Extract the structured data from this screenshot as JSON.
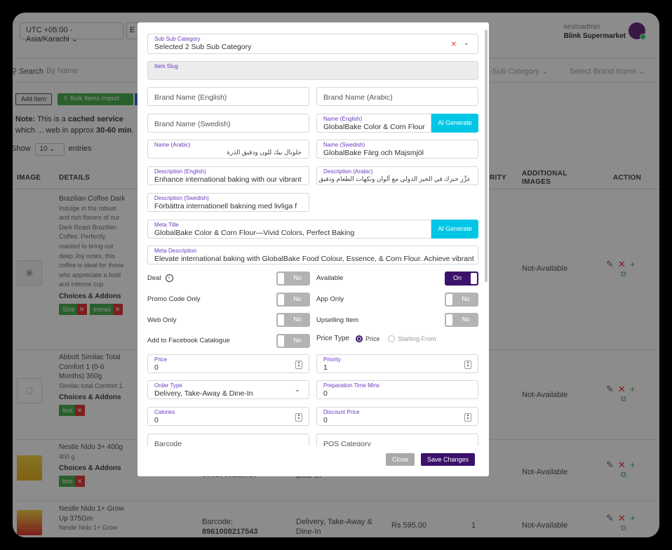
{
  "header": {
    "timezone": "UTC +05:00 - Asia/Karachi",
    "timezone2": "E",
    "username": "nestoadmin",
    "store": "Blink Supermarket"
  },
  "search": {
    "label": "Search",
    "placeholder": "By Name",
    "sub_category": "-Sub Category",
    "brand": "Select Brand Name"
  },
  "toolbar": {
    "add_item": "Add Item",
    "bulk_import": "Bulk Items Import"
  },
  "note": {
    "prefix": "Note:",
    "text1": " This is a ",
    "cached": "cached service",
    "text2": " which ... web in approx ",
    "time": "30-60 min",
    "suffix": "."
  },
  "show": {
    "label": "Show",
    "value": "10",
    "entries": "entries"
  },
  "table": {
    "headers": {
      "image": "IMAGE",
      "details": "DETAILS",
      "priority": "RITY",
      "additional_images": "ADDITIONAL IMAGES",
      "action": "ACTION"
    },
    "rows": [
      {
        "name": "Brazilian Coffee Dark",
        "desc": "Indulge in the robust and rich flavors of our Dark Roast Brazilian Coffee. Perfectly roasted to bring out deep Joy notes, this coffee is ideal for those who appreciate a bold and intense cup.",
        "choices": "Choices & Addons",
        "tags": [
          "Size",
          "extras"
        ],
        "additional": "Not-Available"
      },
      {
        "name": "Abbott Similac Total Comfort 1 (0-6 Months) 360g",
        "desc": "Similac total Comfort 1",
        "choices": "Choices & Addons",
        "tags": [
          "test"
        ],
        "additional": "Not-Available"
      },
      {
        "name": "Nestle Nido 3+ 400g",
        "desc": "400 g",
        "choices": "Choices & Addons",
        "tags": [
          "test"
        ],
        "barcode_partial": "8961008211918",
        "order_partial": "Dine-In",
        "additional": "Not-Available"
      },
      {
        "name": "Nestle Nido 1+ Grow Up 375Gm",
        "desc": "Nestle Nido 1+ Grow",
        "barcode_label": "Barcode:",
        "barcode": "8961008217543",
        "order_type": "Delivery, Take-Away & Dine-In",
        "price": "Rs 595.00",
        "priority": "1",
        "additional": "Not-Available"
      }
    ]
  },
  "modal": {
    "sub_sub_category": {
      "label": "Sub Sub Category",
      "value": "Selected 2 Sub Sub Category"
    },
    "item_slug": {
      "label": "Item Slug",
      "value": ""
    },
    "brand_en": {
      "placeholder": "Brand Name (English)"
    },
    "brand_ar": {
      "placeholder": "Brand Name (Arabic)"
    },
    "brand_sv": {
      "placeholder": "Brand Name (Swedish)"
    },
    "name_en": {
      "label": "Name (English)",
      "value": "GlobalBake Color & Corn Flour"
    },
    "ai_generate": "AI Generate",
    "name_ar": {
      "label": "Name (Arabic)",
      "value": "جلوبال بيك للون ودقيق الذرة"
    },
    "name_sv": {
      "label": "Name (Swedish)",
      "value": "GlobalBake Färg och Majsmjöl"
    },
    "desc_en": {
      "label": "Description (English)",
      "value": "Enhance international baking with our vibrant"
    },
    "desc_ar": {
      "label": "Description (Arabic)",
      "value": "عزِّز خبزك في الخبز الدولي مع ألوان ونكهات الطعام ودقيق الذرة الفو"
    },
    "desc_sv": {
      "label": "Description (Swedish)",
      "value": "Förbättra internationell bakning med livliga f"
    },
    "meta_title": {
      "label": "Meta Title",
      "value": "GlobalBake Color & Corn Flour—Vivid Colors, Perfect Baking"
    },
    "meta_desc": {
      "label": "Meta Description",
      "value": "Elevate international baking with GlobalBake Food Colour, Essence, & Corn Flour. Achieve vibrant"
    },
    "toggles": {
      "deal": {
        "label": "Deal",
        "state": "No"
      },
      "available": {
        "label": "Available",
        "state": "On"
      },
      "promo": {
        "label": "Promo Code Only",
        "state": "No"
      },
      "app_only": {
        "label": "App Only",
        "state": "No"
      },
      "web_only": {
        "label": "Web Only",
        "state": "No"
      },
      "upselling": {
        "label": "Upselling Item",
        "state": "No"
      },
      "facebook": {
        "label": "Add to Facebook Catalogue",
        "state": "No"
      }
    },
    "price_type": {
      "label": "Price Type",
      "opt1": "Price",
      "opt2": "Starting From"
    },
    "price": {
      "label": "Price",
      "value": "0"
    },
    "priority": {
      "label": "Priority",
      "value": "1"
    },
    "order_type": {
      "label": "Order Type",
      "value": "Delivery, Take-Away & Dine-In"
    },
    "prep_time": {
      "label": "Preparation Time Mins",
      "value": "0"
    },
    "calories": {
      "label": "Calories",
      "value": "0"
    },
    "discount": {
      "label": "Discount Price",
      "value": "0"
    },
    "barcode": {
      "placeholder": "Barcode"
    },
    "pos_category": {
      "placeholder": "POS Category"
    },
    "close": "Close",
    "save": "Save Changes"
  },
  "colors": {
    "primary": "#3a116b",
    "ai": "#00c6e6",
    "tag_green": "#4caf50",
    "remove_red": "#e53935"
  }
}
